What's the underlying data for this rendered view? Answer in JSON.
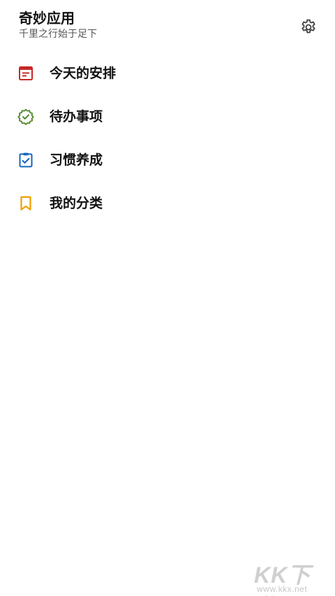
{
  "header": {
    "title": "奇妙应用",
    "subtitle": "千里之行始于足下",
    "settings_icon": "gear-icon"
  },
  "menu": {
    "items": [
      {
        "label": "今天的安排",
        "icon": "calendar-list-icon",
        "color": "#c62828"
      },
      {
        "label": "待办事项",
        "icon": "verified-badge-icon",
        "color": "#558b2f"
      },
      {
        "label": "习惯养成",
        "icon": "clipboard-check-icon",
        "color": "#1565c0"
      },
      {
        "label": "我的分类",
        "icon": "bookmark-icon",
        "color": "#f0a000"
      }
    ]
  },
  "watermark": {
    "logo": "KK下载",
    "url": "www.kkx.net"
  }
}
